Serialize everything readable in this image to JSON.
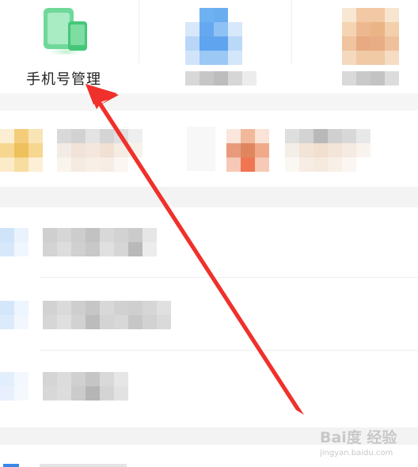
{
  "tiles": [
    {
      "label": "手机号管理",
      "icon": "phone-manage-icon",
      "accent": "#5fd08a"
    },
    {
      "label": "",
      "icon": "clipboard-icon",
      "accent": "#5aa1ef"
    },
    {
      "label": "",
      "icon": "package-icon",
      "accent": "#f2c497"
    }
  ],
  "annotation": {
    "color": "#f0302a"
  },
  "watermark": {
    "logo": "Bai度 经验",
    "url": "jingyan.baidu.com"
  }
}
